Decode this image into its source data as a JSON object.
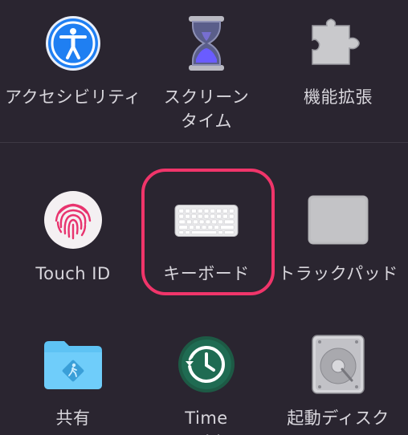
{
  "window": {
    "highlight_color": "#f0356a",
    "background": "#2a2530"
  },
  "prefs_row1": [
    {
      "id": "accessibility",
      "label": "アクセシビリティ",
      "icon": "accessibility-icon"
    },
    {
      "id": "screen-time",
      "label": "スクリーン\nタイム",
      "icon": "hourglass-icon"
    },
    {
      "id": "extensions",
      "label": "機能拡張",
      "icon": "puzzle-piece-icon"
    }
  ],
  "prefs_row2": [
    {
      "id": "touch-id",
      "label": "Touch ID",
      "icon": "fingerprint-icon"
    },
    {
      "id": "keyboard",
      "label": "キーボード",
      "icon": "keyboard-icon",
      "selected": true
    },
    {
      "id": "trackpad",
      "label": "トラックパッド",
      "icon": "trackpad-icon"
    }
  ],
  "prefs_row3": [
    {
      "id": "sharing",
      "label": "共有",
      "icon": "sharing-folder-icon"
    },
    {
      "id": "time-machine",
      "label": "Time\nMachine",
      "icon": "time-machine-icon"
    },
    {
      "id": "startup-disk",
      "label": "起動ディスク",
      "icon": "hard-disk-icon"
    }
  ]
}
